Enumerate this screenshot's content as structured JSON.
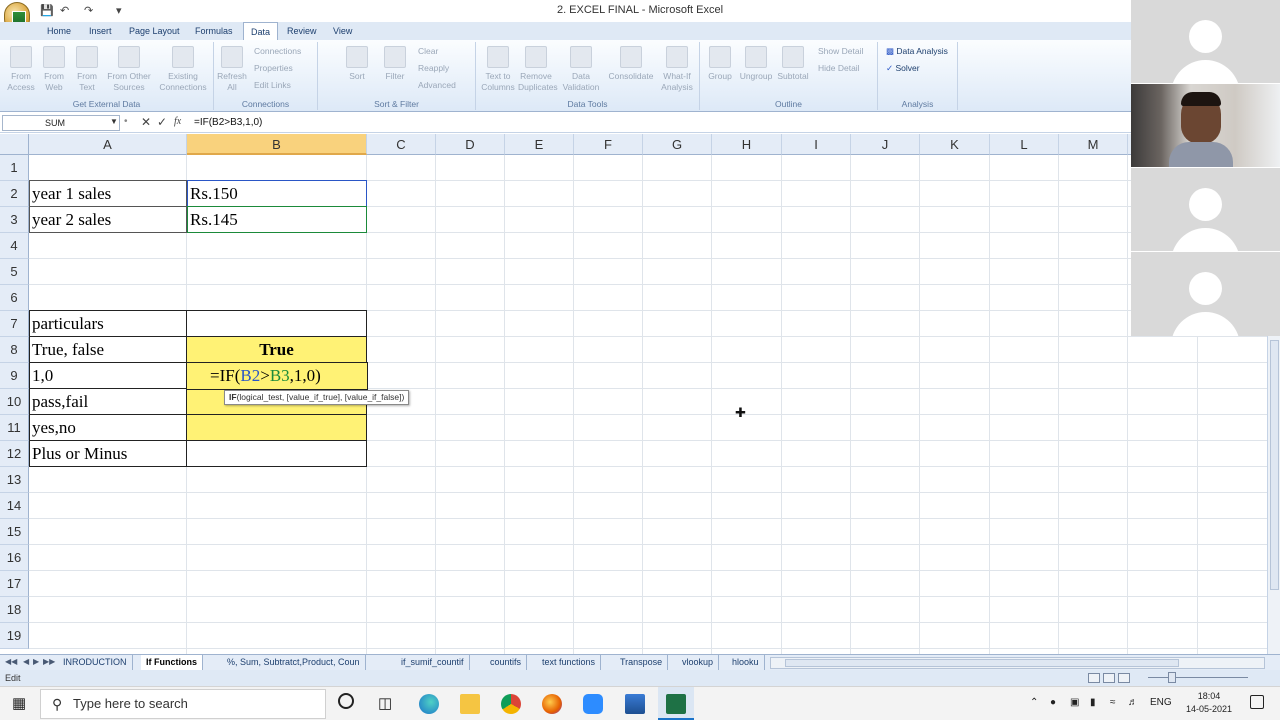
{
  "window": {
    "title": "2. EXCEL FINAL - Microsoft Excel"
  },
  "ribbon_tabs": [
    "Home",
    "Insert",
    "Page Layout",
    "Formulas",
    "Data",
    "Review",
    "View"
  ],
  "active_tab": "Data",
  "ribbon": {
    "get_external_data": {
      "label": "Get External Data",
      "buttons": [
        "From Access",
        "From Web",
        "From Text",
        "From Other Sources",
        "Existing Connections"
      ]
    },
    "connections": {
      "label": "Connections",
      "refresh": "Refresh All",
      "items": [
        "Connections",
        "Properties",
        "Edit Links"
      ]
    },
    "sort_filter": {
      "label": "Sort & Filter",
      "sort": "Sort",
      "filter": "Filter",
      "items": [
        "Clear",
        "Reapply",
        "Advanced"
      ]
    },
    "data_tools": {
      "label": "Data Tools",
      "buttons": [
        "Text to Columns",
        "Remove Duplicates",
        "Data Validation",
        "Consolidate",
        "What-If Analysis"
      ]
    },
    "outline": {
      "label": "Outline",
      "buttons": [
        "Group",
        "Ungroup",
        "Subtotal"
      ],
      "items": [
        "Show Detail",
        "Hide Detail"
      ]
    },
    "analysis": {
      "label": "Analysis",
      "items": [
        "Data Analysis",
        "Solver"
      ]
    }
  },
  "formula_bar": {
    "name_box": "SUM",
    "formula": "=IF(B2>B3,1,0)"
  },
  "columns": [
    "A",
    "B",
    "C",
    "D",
    "E",
    "F",
    "G",
    "H",
    "I",
    "J",
    "K",
    "L",
    "M"
  ],
  "rows": [
    "1",
    "2",
    "3",
    "4",
    "5",
    "6",
    "7",
    "8",
    "9",
    "10",
    "11",
    "12",
    "13",
    "14",
    "15",
    "16",
    "17",
    "18",
    "19"
  ],
  "cells": {
    "A2": "year 1 sales",
    "B2": "Rs.150",
    "A3": "year 2 sales",
    "B3": "Rs.145",
    "A7": "particulars",
    "A8": "True, false",
    "B8": "True",
    "A9": "1,0",
    "A10": "pass,fail",
    "A11": "yes,no",
    "A12": "Plus or Minus"
  },
  "edit_cell": {
    "prefix": "=IF(",
    "ref1": "B2",
    "op": ">",
    "ref2": "B3",
    "suffix": ",1,0)"
  },
  "tooltip": "IF(logical_test, [value_if_true], [value_if_false])",
  "tooltip_bold": "IF",
  "sheet_tabs": [
    "INRODUCTION",
    "If Functions",
    "%, Sum, Subtratct,Product, Coun",
    "if_sumif_countif",
    "countifs",
    "text functions",
    "Transpose",
    "vlookup",
    "hlooku"
  ],
  "active_sheet": "If Functions",
  "status": "Edit",
  "taskbar": {
    "search_placeholder": "Type here to search",
    "language": "ENG",
    "time": "18:04",
    "date": "14-05-2021"
  },
  "colors": {
    "highlight_yellow": "#fff275",
    "header_selected": "#f9d27d",
    "ref_blue": "#2a56c6",
    "ref_green": "#1b8a3a"
  }
}
